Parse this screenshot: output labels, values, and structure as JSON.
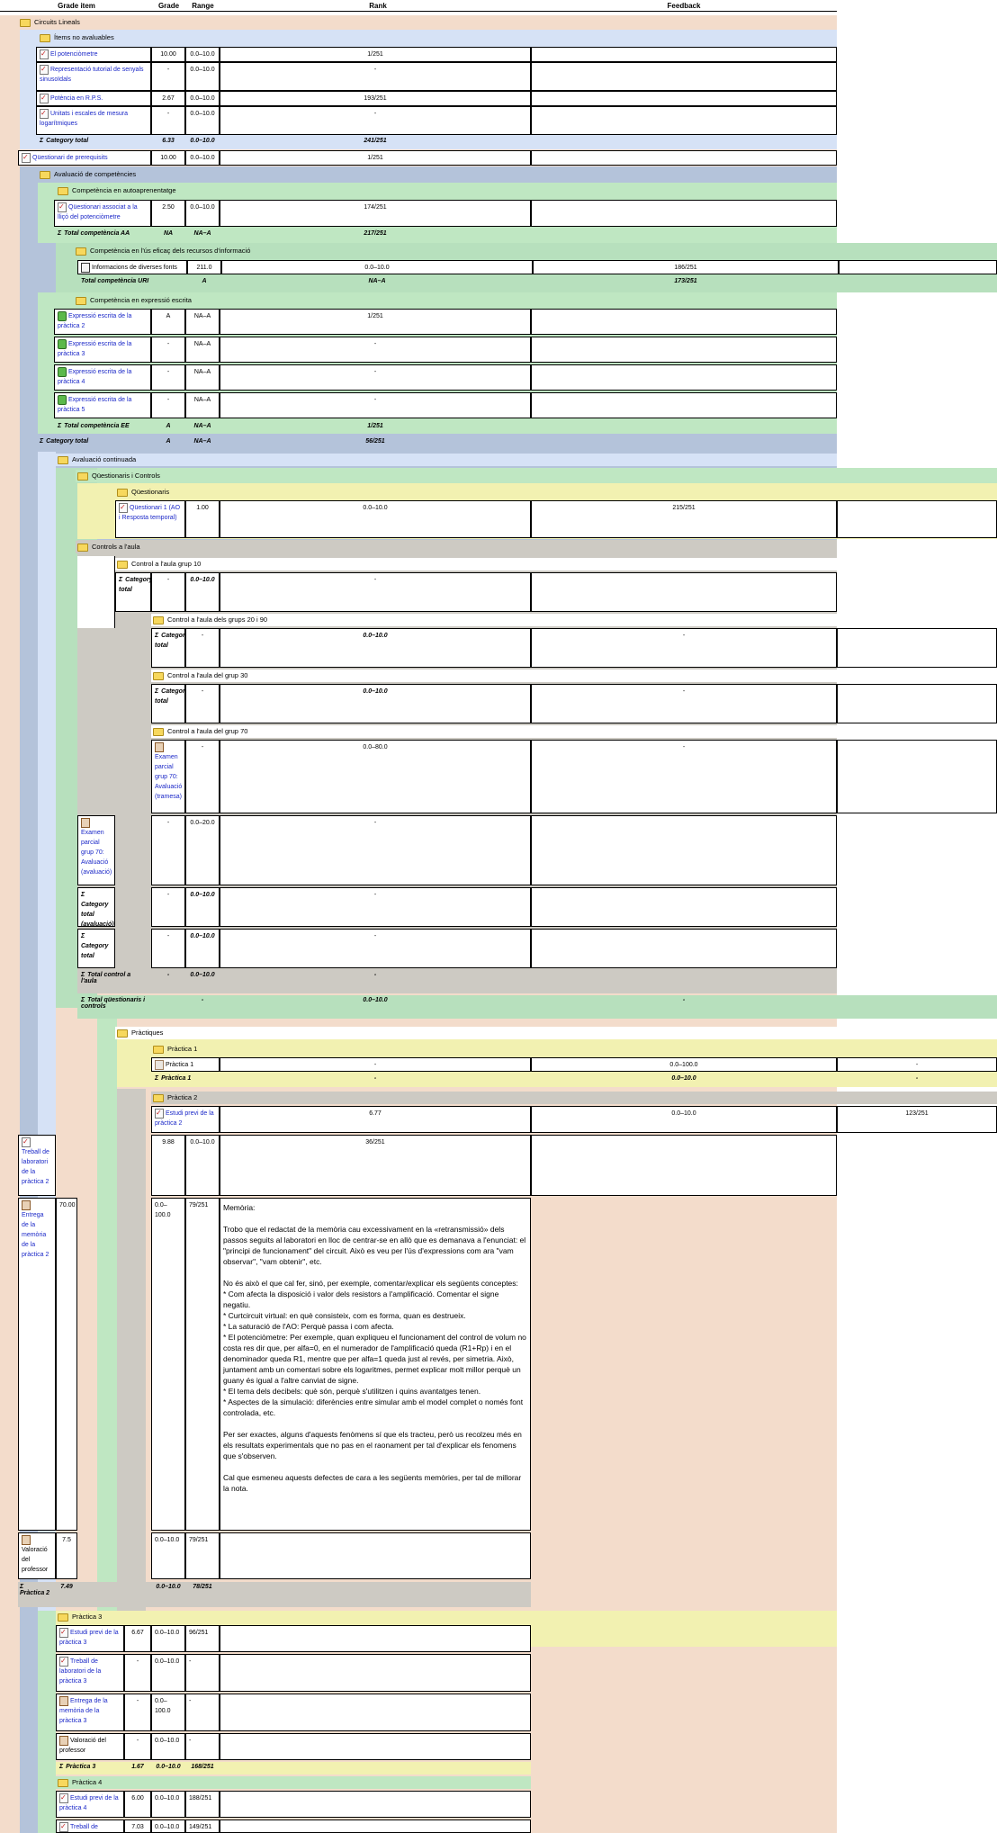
{
  "columns": {
    "item": "Grade item",
    "grade": "Grade",
    "range": "Range",
    "rank": "Rank",
    "feedback": "Feedback"
  },
  "colors": {
    "peach": "#f3dccb",
    "blue": "#d6e2f6",
    "slate": "#b4c3da",
    "green": "#bfe7c2",
    "green2": "#b7e0bd",
    "yellow": "#f2f1b1",
    "gray": "#cdcac3",
    "link": "#1b28c8"
  },
  "cats": {
    "circuits": "Circuits Lineals",
    "noaval": "Ítems no avaluables",
    "avalcomp": "Avaluació de competències",
    "autoap": "Competència en autoaprenentatge",
    "recursos": "Competència en l'ús eficaç dels recursos d'informació",
    "expressio": "Competència en expressió escrita",
    "continuada": "Avaluació continuada",
    "qcontrols": "Qüestionaris i Controls",
    "questionaris": "Qüestionaris",
    "controls": "Controls a l'aula",
    "grup10": "Control a l'aula grup 10",
    "grup20": "Control a l'aula dels grups 20 i 90",
    "grup30": "Control a l'aula del grup 30",
    "grup70": "Control a l'aula del grup 70",
    "practiques": "Pràctiques",
    "p1": "Pràctica 1",
    "p2": "Pràctica 2",
    "p3": "Pràctica 3",
    "p4": "Pràctica 4"
  },
  "items": {
    "pot": {
      "name": "El potenciòmetre",
      "grade": "10.00",
      "range": "0.0–10.0",
      "rank": "1/251",
      "feedback": ""
    },
    "repr": {
      "name": "Representació tutorial de senyals sinusoïdals",
      "grade": "-",
      "range": "0.0–10.0",
      "rank": "-",
      "feedback": ""
    },
    "potrps": {
      "name": "Potència en R.P.S.",
      "grade": "2.67",
      "range": "0.0–10.0",
      "rank": "193/251",
      "feedback": ""
    },
    "unitats": {
      "name": "Unitats i escales de mesura logarítmiques",
      "grade": "-",
      "range": "0.0–10.0",
      "rank": "-",
      "feedback": ""
    },
    "noavaltot": {
      "name": "Category total",
      "grade": "6.33",
      "range": "0.0–10.0",
      "rank": "241/251"
    },
    "prereq": {
      "name": "Qüestionari de prerequisits",
      "grade": "10.00",
      "range": "0.0–10.0",
      "rank": "1/251",
      "feedback": ""
    },
    "qassoc": {
      "name": "Qüestionari associat a la lliçó del potenciòmetre",
      "grade": "2.50",
      "range": "0.0–10.0",
      "rank": "174/251",
      "feedback": ""
    },
    "totaa": {
      "name": "Total competència AA",
      "grade": "NA",
      "range": "NA–A",
      "rank": "217/251"
    },
    "inform": {
      "name": "Informacions de diverses fonts",
      "grade": "211.0",
      "range": "0.0–10.0",
      "rank": "186/251",
      "feedback": ""
    },
    "toturi": {
      "name": "Total competència URI",
      "grade": "A",
      "range": "NA–A",
      "rank": "173/251"
    },
    "exp2": {
      "name": "Expressió escrita de la pràctica 2",
      "grade": "A",
      "range": "NA–A",
      "rank": "1/251",
      "feedback": ""
    },
    "exp3": {
      "name": "Expressió escrita de la pràctica 3",
      "grade": "-",
      "range": "NA–A",
      "rank": "-",
      "feedback": ""
    },
    "exp4": {
      "name": "Expressió escrita de la pràctica 4",
      "grade": "-",
      "range": "NA–A",
      "rank": "-",
      "feedback": ""
    },
    "exp5": {
      "name": "Expressió escrita de la pràctica 5",
      "grade": "-",
      "range": "NA–A",
      "rank": "-",
      "feedback": ""
    },
    "totee": {
      "name": "Total competència EE",
      "grade": "A",
      "range": "NA–A",
      "rank": "1/251"
    },
    "cattot1": {
      "name": "Category total",
      "grade": "A",
      "range": "NA–A",
      "rank": "56/251"
    },
    "q1": {
      "name": "Qüestionari 1 (AO i Resposta temporal)",
      "grade": "1.00",
      "range": "0.0–10.0",
      "rank": "215/251",
      "feedback": ""
    },
    "g10tot": {
      "name": "Category total",
      "grade": "-",
      "range": "0.0–10.0",
      "rank": "-"
    },
    "g20tot": {
      "name": "Category total",
      "grade": "-",
      "range": "0.0–10.0",
      "rank": "-"
    },
    "g30tot": {
      "name": "Category total",
      "grade": "-",
      "range": "0.0–10.0",
      "rank": "-"
    },
    "ex70tr": {
      "name": "Examen parcial grup 70: Avaluació (tramesa)",
      "grade": "-",
      "range": "0.0–80.0",
      "rank": "-"
    },
    "ex70av": {
      "name": "Examen parcial grup 70: Avaluació (avaluació)",
      "grade": "-",
      "range": "0.0–20.0",
      "rank": "-"
    },
    "ex70cat": {
      "name": "Category total (avaluació)",
      "grade": "-",
      "range": "0.0–10.0",
      "rank": "-"
    },
    "g70tot": {
      "name": "Category total",
      "grade": "-",
      "range": "0.0–10.0",
      "rank": "-"
    },
    "totctrl": {
      "name": "Total control a l'aula",
      "grade": "-",
      "range": "0.0–10.0",
      "rank": "-"
    },
    "totqc": {
      "name": "Total qüestionaris i controls",
      "grade": "-",
      "range": "0.0–10.0",
      "rank": "-"
    },
    "pr1": {
      "name": "Pràctica 1",
      "grade": "-",
      "range": "0.0–100.0",
      "rank": "-"
    },
    "pr1tot": {
      "name": "Pràctica 1",
      "grade": "-",
      "range": "0.0–10.0",
      "rank": "-"
    },
    "ep2": {
      "name": "Estudi previ de la pràctica 2",
      "grade": "6.77",
      "range": "0.0–10.0",
      "rank": "123/251"
    },
    "tl2": {
      "name": "Treball de laboratori de la pràctica 2",
      "grade": "9.88",
      "range": "0.0–10.0",
      "rank": "36/251"
    },
    "em2": {
      "name": "Entrega de la memòria de la pràctica 2",
      "grade": "70.00",
      "range": "0.0–100.0",
      "rank": "79/251"
    },
    "vp2": {
      "name": "Valoració del professor",
      "grade": "7.5",
      "range": "0.0–10.0",
      "rank": "79/251"
    },
    "p2tot": {
      "name": "Pràctica 2",
      "grade": "7.49",
      "range": "0.0–10.0",
      "rank": "78/251"
    },
    "ep3": {
      "name": "Estudi previ de la pràctica 3",
      "grade": "6.67",
      "range": "0.0–10.0",
      "rank": "96/251"
    },
    "tl3": {
      "name": "Treball de laboratori de la pràctica 3",
      "grade": "-",
      "range": "0.0–10.0",
      "rank": "-"
    },
    "em3": {
      "name": "Entrega de la memòria de la pràctica 3",
      "grade": "-",
      "range": "0.0–100.0",
      "rank": "-"
    },
    "vp3": {
      "name": "Valoració del professor",
      "grade": "-",
      "range": "0.0–10.0",
      "rank": "-"
    },
    "p3tot": {
      "name": "Pràctica 3",
      "grade": "1.67",
      "range": "0.0–10.0",
      "rank": "168/251"
    },
    "ep4": {
      "name": "Estudi previ de la pràctica 4",
      "grade": "6.00",
      "range": "0.0–10.0",
      "rank": "188/251"
    },
    "tl4": {
      "name": "Treball de",
      "grade": "7.03",
      "range": "0.0–10.0",
      "rank": "149/251"
    }
  },
  "memo": "Memòria:\n\nTrobo que el redactat de la memòria cau excessivament en la «retransmissió» dels passos seguits al laboratori en lloc de centrar-se en allò que es demanava a l'enunciat: el \"principi de funcionament\" del circuit. Això es veu per l'ús d'expressions com ara \"vam observar\", \"vam obtenir\", etc.\n\nNo és això el que cal fer, sinó, per exemple, comentar/explicar els següents conceptes:\n* Com afecta la disposició i valor dels resistors a l'amplificació. Comentar el signe negatiu.\n* Curtcircuit virtual: en què consisteix, com es forma, quan es destrueix.\n* La saturació de l'AO: Perquè passa i com afecta.\n* El potenciòmetre: Per exemple, quan expliqueu el funcionament del control de volum no costa res dir que, per alfa=0, en el numerador de l'amplificació queda (R1+Rp) i en el denominador queda R1, mentre que per alfa=1 queda just al revés, per simetria. Això, juntament amb un comentari sobre els logaritmes, permet explicar molt millor perquè un guany és igual a l'altre canviat de signe.\n* El tema dels decibels: què són, perquè s'utilitzen i quins avantatges tenen.\n* Aspectes de la simulació: diferències entre simular amb el model complet o només font controlada, etc.\n\nPer ser exactes, alguns d'aquests fenòmens sí que els tracteu, però us recolzeu més en els resultats experimentals que no pas en el raonament per tal d'explicar els fenomens que s'observen.\n\nCal que esmeneu aquests defectes de cara a les següents memòries, per tal de millorar la nota."
}
